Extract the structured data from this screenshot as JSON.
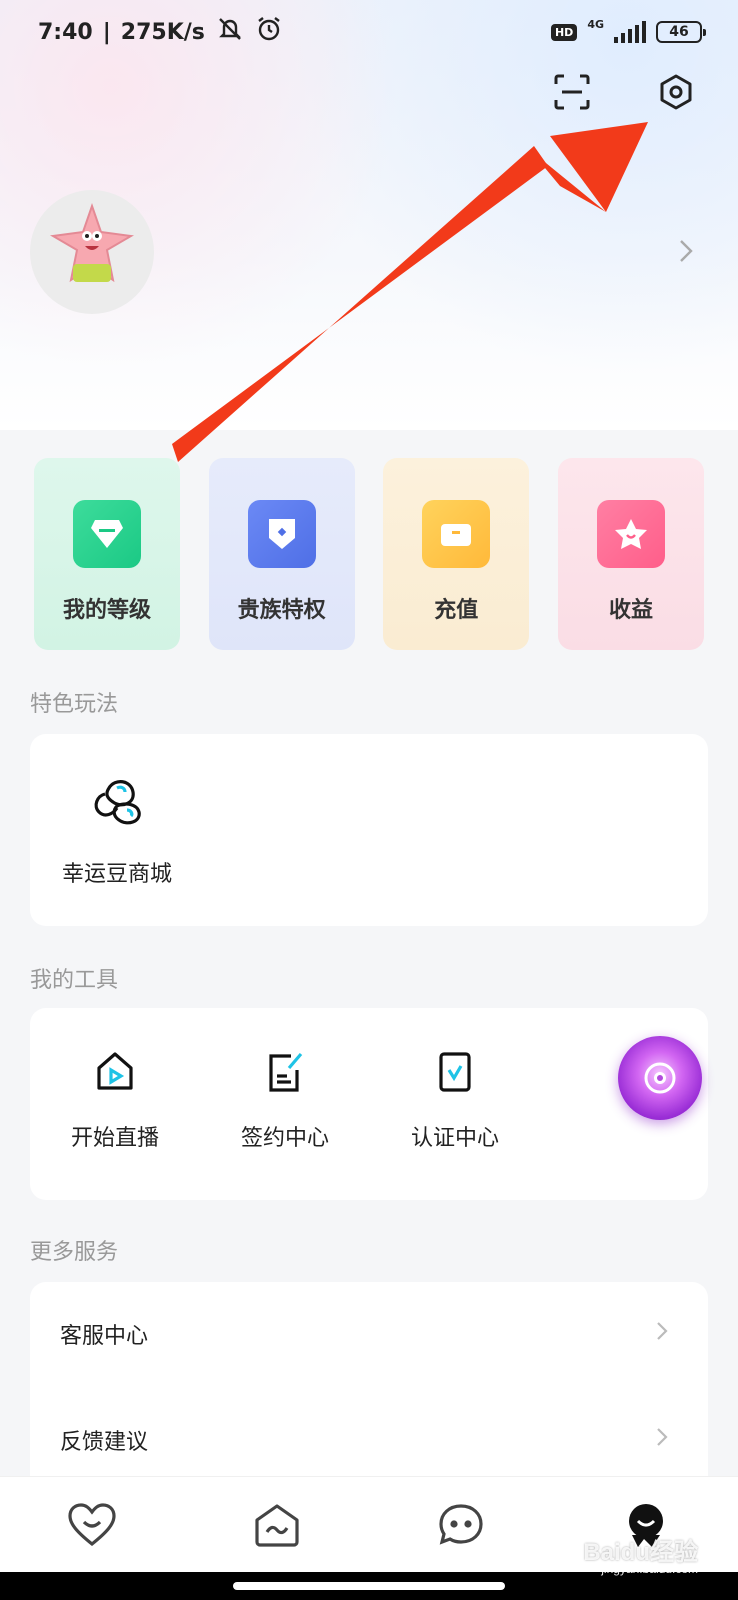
{
  "status_bar": {
    "time": "7:40",
    "separator": "|",
    "speed": "275K/s",
    "hd": "HD",
    "network": "4G",
    "battery": "46"
  },
  "header": {
    "icons": [
      "scan-icon",
      "settings-icon"
    ]
  },
  "quick_cards": [
    {
      "label": "我的等级",
      "icon": "gem-icon",
      "color": "#1bc985"
    },
    {
      "label": "贵族特权",
      "icon": "shield-icon",
      "color": "#4f6fe6"
    },
    {
      "label": "充值",
      "icon": "wallet-icon",
      "color": "#ffb93a"
    },
    {
      "label": "收益",
      "icon": "star-icon",
      "color": "#ff5e8a"
    }
  ],
  "features": {
    "title": "特色玩法",
    "items": [
      {
        "label": "幸运豆商城",
        "icon": "beans-icon"
      }
    ]
  },
  "tools": {
    "title": "我的工具",
    "items": [
      {
        "label": "开始直播",
        "icon": "live-icon"
      },
      {
        "label": "签约中心",
        "icon": "sign-icon"
      },
      {
        "label": "认证中心",
        "icon": "verify-icon"
      }
    ]
  },
  "services": {
    "title": "更多服务",
    "items": [
      {
        "label": "客服中心"
      },
      {
        "label": "反馈建议"
      }
    ]
  },
  "bottom_nav": [
    "heart-icon",
    "square-icon",
    "chat-icon",
    "profile-icon"
  ],
  "watermark": {
    "text": "Baidu经验",
    "sub": "jingyan.baidu.com"
  },
  "colors": {
    "accent": "#1ec3e6",
    "annotation_arrow": "#f23a1a"
  }
}
